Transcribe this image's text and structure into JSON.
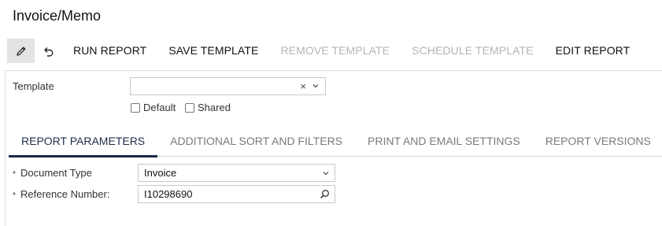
{
  "page": {
    "title": "Invoice/Memo"
  },
  "toolbar": {
    "edit_icon": "pencil-icon",
    "undo_icon": "undo-icon",
    "run_report": "RUN REPORT",
    "save_template": "SAVE TEMPLATE",
    "remove_template": "REMOVE TEMPLATE",
    "schedule_template": "SCHEDULE TEMPLATE",
    "edit_report": "EDIT REPORT"
  },
  "template": {
    "label": "Template",
    "value": "",
    "clear_icon": "×",
    "default_label": "Default",
    "default_checked": false,
    "shared_label": "Shared",
    "shared_checked": false
  },
  "tabs": [
    {
      "label": "REPORT PARAMETERS",
      "active": true
    },
    {
      "label": "ADDITIONAL SORT AND FILTERS",
      "active": false
    },
    {
      "label": "PRINT AND EMAIL SETTINGS",
      "active": false
    },
    {
      "label": "REPORT VERSIONS",
      "active": false
    }
  ],
  "parameters": {
    "required_marker": "*",
    "document_type": {
      "label": "Document Type",
      "value": "Invoice"
    },
    "reference_number": {
      "label": "Reference Number:",
      "value": "I10298690"
    }
  },
  "colors": {
    "active_tab_underline": "#1b2a48",
    "disabled_text": "#b4b4b4",
    "active_tool_bg": "#e3e3e3"
  }
}
